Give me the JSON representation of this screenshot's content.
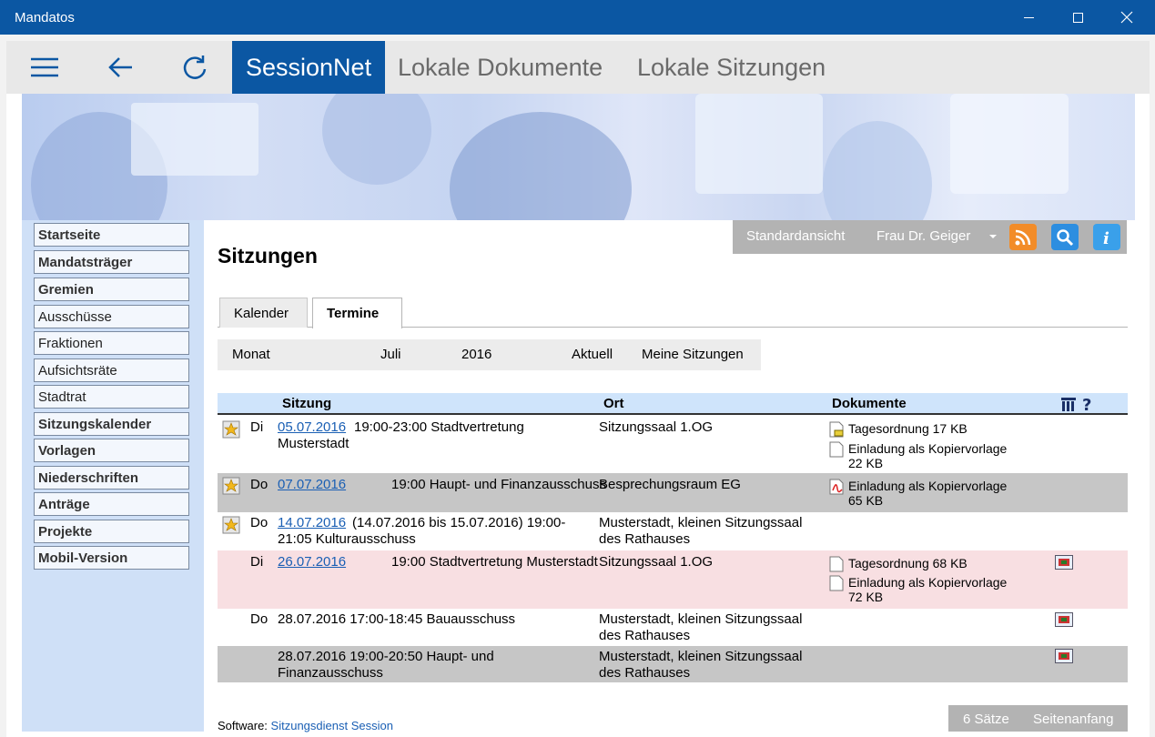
{
  "window": {
    "title": "Mandatos"
  },
  "toolbar": {
    "tabs": [
      {
        "label": "SessionNet"
      },
      {
        "label": "Lokale Dokumente"
      },
      {
        "label": "Lokale Sitzungen"
      }
    ]
  },
  "sidebar": {
    "items": [
      {
        "label": "Startseite"
      },
      {
        "label": "Mandatsträger"
      },
      {
        "label": "Gremien"
      },
      {
        "label": "Ausschüsse"
      },
      {
        "label": "Fraktionen"
      },
      {
        "label": "Aufsichtsräte"
      },
      {
        "label": "Stadtrat"
      },
      {
        "label": "Sitzungskalender"
      },
      {
        "label": "Vorlagen"
      },
      {
        "label": "Niederschriften"
      },
      {
        "label": "Anträge"
      },
      {
        "label": "Projekte"
      },
      {
        "label": "Mobil-Version"
      }
    ]
  },
  "actionbar": {
    "view": "Standardansicht",
    "user": "Frau Dr. Geiger"
  },
  "page": {
    "title": "Sitzungen"
  },
  "tabs": {
    "kalender": "Kalender",
    "termine": "Termine"
  },
  "filter": {
    "monat_label": "Monat",
    "month": "Juli",
    "year": "2016",
    "aktuell": "Aktuell",
    "meine": "Meine Sitzungen"
  },
  "table": {
    "headers": {
      "sitzung": "Sitzung",
      "ort": "Ort",
      "dokumente": "Dokumente"
    },
    "rows": [
      {
        "day": "Di",
        "date": "05.07.2016",
        "text1": "19:00-23:00 Stadtvertretung",
        "text2": "Musterstadt",
        "ort1": "Sitzungssaal 1.OG",
        "ort2": "",
        "docs": [
          {
            "t1": "Tagesordnung 17 KB",
            "t2": ""
          },
          {
            "t1": "Einladung als Kopiervorlage",
            "t2": "22 KB"
          }
        ]
      },
      {
        "day": "Do",
        "date": "07.07.2016",
        "text1": "19:00 Haupt- und Finanzausschuss",
        "text2": "",
        "ort1": "Besprechungsraum EG",
        "ort2": "",
        "docs": [
          {
            "t1": "Einladung als Kopiervorlage",
            "t2": "65 KB"
          }
        ]
      },
      {
        "day": "Do",
        "date": "14.07.2016",
        "text1": "(14.07.2016 bis 15.07.2016) 19:00-",
        "text2": "21:05 Kulturausschuss",
        "ort1": "Musterstadt, kleinen Sitzungssaal",
        "ort2": "des Rathauses",
        "docs": []
      },
      {
        "day": "Di",
        "date": "26.07.2016",
        "text1": "19:00 Stadtvertretung Musterstadt",
        "text2": "",
        "ort1": "Sitzungssaal 1.OG",
        "ort2": "",
        "docs": [
          {
            "t1": "Tagesordnung 68 KB",
            "t2": ""
          },
          {
            "t1": "Einladung als Kopiervorlage",
            "t2": "72 KB"
          }
        ]
      },
      {
        "day": "Do",
        "date": "",
        "text1": "28.07.2016 17:00-18:45 Bauausschuss",
        "text2": "",
        "ort1": "Musterstadt, kleinen Sitzungssaal",
        "ort2": "des Rathauses",
        "docs": []
      },
      {
        "day": "",
        "date": "",
        "text1": "28.07.2016 19:00-20:50 Haupt- und",
        "text2": "Finanzausschuss",
        "ort1": "Musterstadt, kleinen Sitzungssaal",
        "ort2": "des Rathauses",
        "docs": []
      }
    ]
  },
  "footer": {
    "software_label": "Software:",
    "software_link": "Sitzungsdienst Session",
    "count": "6 Sätze",
    "top": "Seitenanfang"
  },
  "colors": {
    "accent": "#0b57a3",
    "sidebar": "#cfe0f7",
    "row_gray": "#c6c6c6",
    "row_pink": "#f8dfe2",
    "link": "#1a5fb4"
  }
}
